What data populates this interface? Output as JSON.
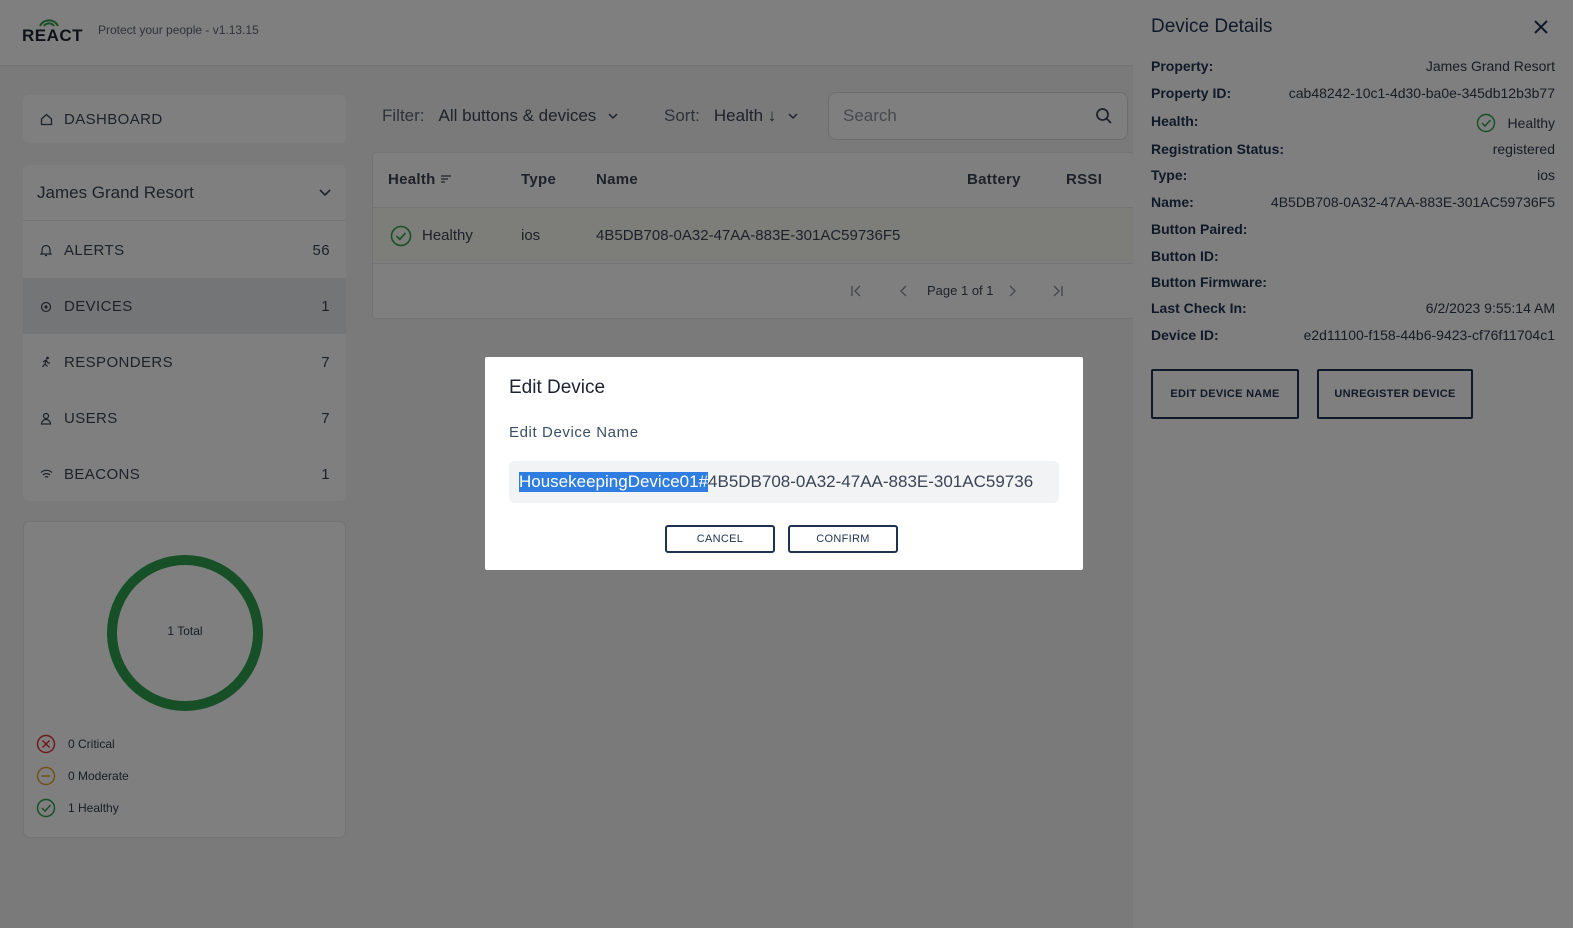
{
  "header": {
    "logo_text": "REACT",
    "tagline": "Protect your people - v1.13.15"
  },
  "sidebar": {
    "dashboard_label": "DASHBOARD",
    "property_name": "James Grand Resort",
    "items": [
      {
        "label": "ALERTS",
        "count": "56",
        "icon": "bell-icon"
      },
      {
        "label": "DEVICES",
        "count": "1",
        "icon": "device-icon"
      },
      {
        "label": "RESPONDERS",
        "count": "7",
        "icon": "runner-icon"
      },
      {
        "label": "USERS",
        "count": "7",
        "icon": "user-icon"
      },
      {
        "label": "BEACONS",
        "count": "1",
        "icon": "wifi-icon"
      }
    ],
    "health_summary": {
      "total_label": "1 Total",
      "critical": "0 Critical",
      "moderate": "0 Moderate",
      "healthy": "1 Healthy",
      "colors": {
        "critical": "#d9363e",
        "moderate": "#e0a32e",
        "healthy": "#2e9e4f"
      }
    }
  },
  "toolbar": {
    "filter_key": "Filter:",
    "filter_value": "All buttons & devices",
    "sort_key": "Sort:",
    "sort_value": "Health ↓",
    "search_placeholder": "Search"
  },
  "table": {
    "headers": [
      "Health",
      "Type",
      "Name",
      "Battery",
      "RSSI"
    ],
    "rows": [
      {
        "health": "Healthy",
        "type": "ios",
        "name": "4B5DB708-0A32-47AA-883E-301AC59736F5"
      }
    ],
    "page_label": "Page 1 of 1"
  },
  "details": {
    "title": "Device Details",
    "fields": [
      {
        "key": "Property:",
        "value": "James Grand Resort"
      },
      {
        "key": "Property ID:",
        "value": "cab48242-10c1-4d30-ba0e-345db12b3b77"
      },
      {
        "key": "Health:",
        "value": "Healthy"
      },
      {
        "key": "Registration Status:",
        "value": "registered"
      },
      {
        "key": "Type:",
        "value": "ios"
      },
      {
        "key": "Name:",
        "value": "4B5DB708-0A32-47AA-883E-301AC59736F5"
      },
      {
        "key": "Button Paired:",
        "value": ""
      },
      {
        "key": "Button ID:",
        "value": ""
      },
      {
        "key": "Button Firmware:",
        "value": ""
      },
      {
        "key": "Last Check In:",
        "value": "6/2/2023 9:55:14 AM"
      },
      {
        "key": "Device ID:",
        "value": "e2d11100-f158-44b6-9423-cf76f11704c1"
      }
    ],
    "edit_button": "EDIT DEVICE NAME",
    "unregister_button": "UNREGISTER DEVICE"
  },
  "modal": {
    "title": "Edit Device",
    "label": "Edit Device Name",
    "input_selected": "HousekeepingDevice01#",
    "input_rest": "4B5DB708-0A32-47AA-883E-301AC59736",
    "cancel": "CANCEL",
    "confirm": "CONFIRM"
  }
}
